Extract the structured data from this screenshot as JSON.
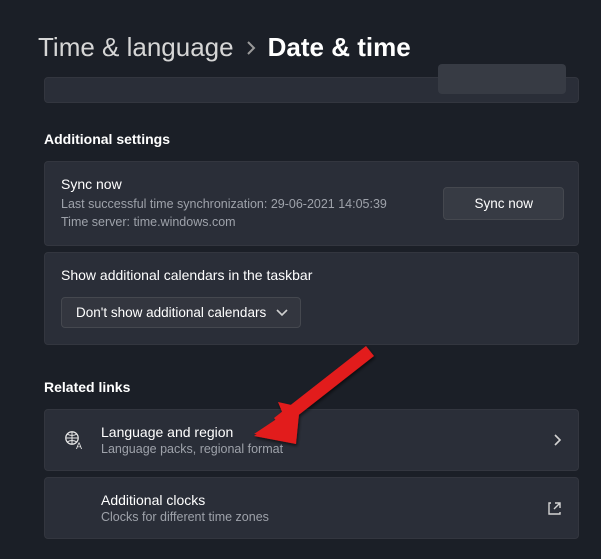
{
  "breadcrumb": {
    "parent": "Time & language",
    "current": "Date & time"
  },
  "sections": {
    "additional_settings": "Additional settings",
    "related_links": "Related links"
  },
  "sync": {
    "title": "Sync now",
    "last_sync": "Last successful time synchronization: 29-06-2021 14:05:39",
    "server": "Time server: time.windows.com",
    "button": "Sync now"
  },
  "calendars": {
    "label": "Show additional calendars in the taskbar",
    "selected": "Don't show additional calendars"
  },
  "links": {
    "language": {
      "title": "Language and region",
      "sub": "Language packs, regional format"
    },
    "clocks": {
      "title": "Additional clocks",
      "sub": "Clocks for different time zones"
    }
  }
}
